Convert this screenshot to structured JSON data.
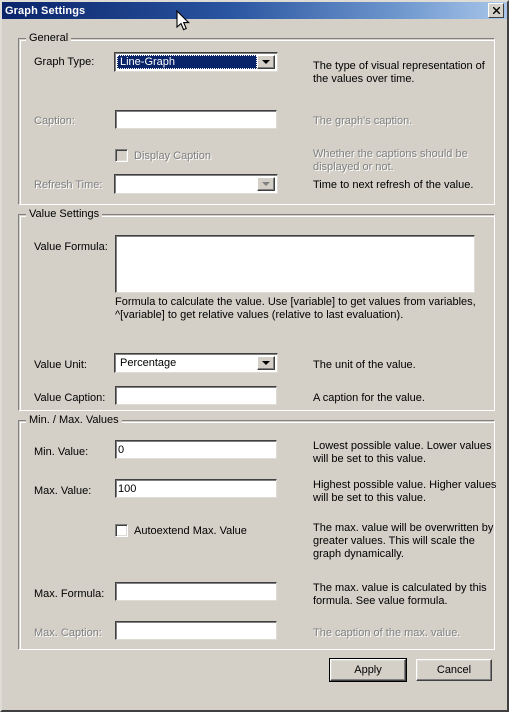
{
  "window": {
    "title": "Graph Settings",
    "close_label": "✕",
    "titlebar_gradient_start": "#0a246a",
    "titlebar_gradient_end": "#a9c6ea",
    "face_color": "#d4d0c8"
  },
  "groups": {
    "general": {
      "title": "General",
      "rows": {
        "graph_type": {
          "label": "Graph Type:",
          "value": "Line-Graph",
          "description": "The type of visual representation of the values over time.",
          "enabled": true,
          "focused": true
        },
        "caption": {
          "label": "Caption:",
          "value": "",
          "placeholder": "",
          "description": "The graph's caption.",
          "enabled": false
        },
        "display_caption": {
          "label": "Display Caption",
          "checked": false,
          "description": "Whether the captions should be displayed or not.",
          "enabled": false
        },
        "refresh_time": {
          "label": "Refresh Time:",
          "value": "",
          "description": "Time to next refresh of the value.",
          "enabled": false
        }
      }
    },
    "value_settings": {
      "title": "Value Settings",
      "rows": {
        "value_formula": {
          "label": "Value Formula:",
          "value": "",
          "placeholder": "",
          "description": "Formula to calculate the value. Use [variable] to get values from variables, ^[variable] to get relative values (relative to last evaluation).",
          "enabled": true
        },
        "value_unit": {
          "label": "Value Unit:",
          "value": "Percentage",
          "description": "The unit of the value.",
          "enabled": true
        },
        "value_caption": {
          "label": "Value Caption:",
          "value": "",
          "placeholder": "",
          "description": "A caption for the value.",
          "enabled": true
        }
      }
    },
    "min_max_values": {
      "title": "Min. / Max. Values",
      "rows": {
        "min_value": {
          "label": "Min. Value:",
          "value": "0",
          "description": "Lowest possible value. Lower values will be set to this value.",
          "enabled": true
        },
        "max_value": {
          "label": "Max. Value:",
          "value": "100",
          "description": "Highest possible value. Higher values will be set to this value.",
          "enabled": true
        },
        "autoextend_max_value": {
          "label": "Autoextend Max. Value",
          "checked": false,
          "description": "The max. value will be overwritten by greater values. This will scale the graph dynamically.",
          "enabled": true
        },
        "max_formula": {
          "label": "Max. Formula:",
          "value": "",
          "placeholder": "",
          "description": "The max. value is calculated by this formula. See value formula.",
          "enabled": true
        },
        "max_caption": {
          "label": "Max. Caption:",
          "value": "",
          "placeholder": "",
          "description": "The caption of the max. value.",
          "enabled": false
        }
      }
    }
  },
  "buttons": {
    "apply": "Apply",
    "cancel": "Cancel"
  }
}
